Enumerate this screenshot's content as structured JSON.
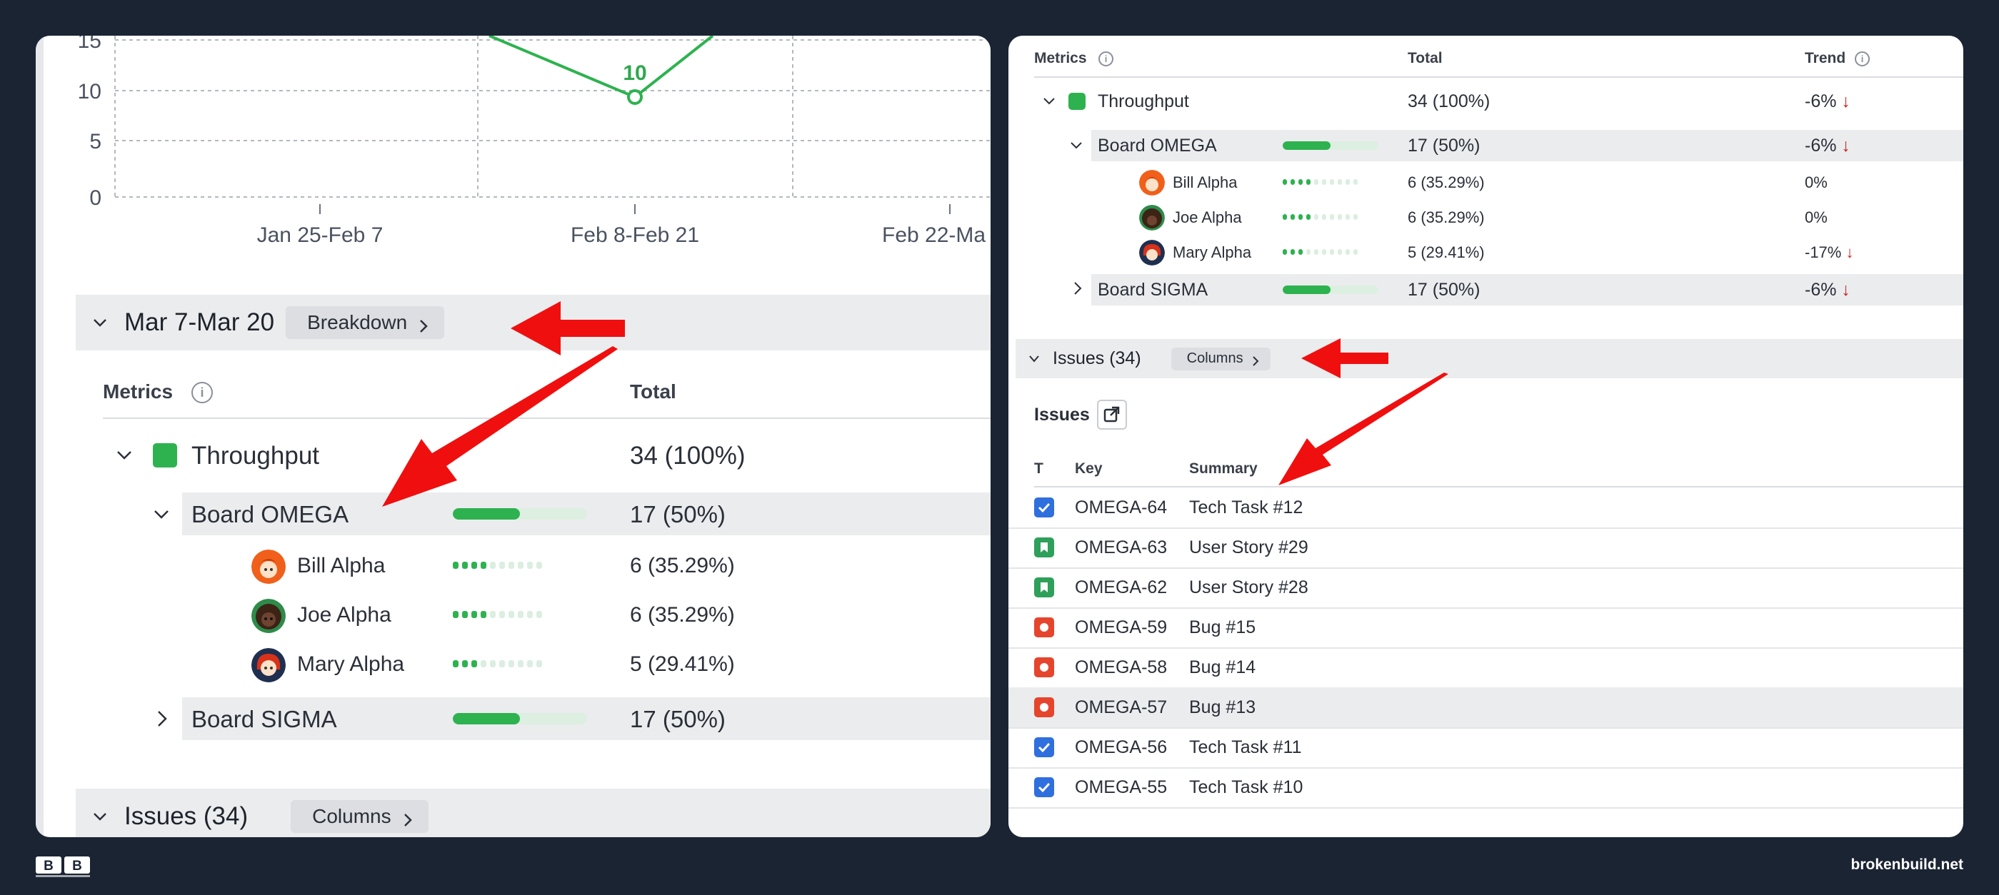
{
  "left": {
    "chart": {
      "y_ticks": [
        "15",
        "10",
        "5",
        "0"
      ],
      "x_ticks": [
        "Jan 25-Feb 7",
        "Feb 8-Feb 21",
        "Feb 22-Ma"
      ],
      "point_label": "10",
      "line_color": "#2eb24f"
    },
    "period": {
      "label": "Mar 7-Mar 20",
      "button": "Breakdown"
    },
    "metrics": {
      "col_metrics": "Metrics",
      "col_total": "Total",
      "throughput": {
        "label": "Throughput",
        "total": "34 (100%)"
      },
      "board_omega": {
        "label": "Board OMEGA",
        "total": "17 (50%)",
        "progress": 0.5
      },
      "people": [
        {
          "name": "Bill Alpha",
          "total": "6 (35.29%)",
          "dots_on": 4,
          "avatar": "red-hair-avatar"
        },
        {
          "name": "Joe Alpha",
          "total": "6 (35.29%)",
          "dots_on": 4,
          "avatar": "dark-hair-avatar"
        },
        {
          "name": "Mary Alpha",
          "total": "5 (29.41%)",
          "dots_on": 3,
          "avatar": "red-hair-woman-avatar"
        }
      ],
      "board_sigma": {
        "label": "Board SIGMA",
        "total": "17 (50%)",
        "progress": 0.5
      }
    },
    "issues_bar": {
      "label": "Issues (34)",
      "button": "Columns"
    }
  },
  "right": {
    "metrics": {
      "col_metrics": "Metrics",
      "col_total": "Total",
      "col_trend": "Trend",
      "throughput": {
        "label": "Throughput",
        "total": "34 (100%)",
        "trend": "-6%",
        "trend_down": true
      },
      "board_omega": {
        "label": "Board OMEGA",
        "total": "17 (50%)",
        "trend": "-6%",
        "trend_down": true,
        "progress": 0.5
      },
      "people": [
        {
          "name": "Bill Alpha",
          "total": "6 (35.29%)",
          "trend": "0%",
          "trend_down": false,
          "dots_on": 4
        },
        {
          "name": "Joe Alpha",
          "total": "6 (35.29%)",
          "trend": "0%",
          "trend_down": false,
          "dots_on": 4
        },
        {
          "name": "Mary Alpha",
          "total": "5 (29.41%)",
          "trend": "-17%",
          "trend_down": true,
          "dots_on": 3
        }
      ],
      "board_sigma": {
        "label": "Board SIGMA",
        "total": "17 (50%)",
        "trend": "-6%",
        "trend_down": true,
        "progress": 0.5
      }
    },
    "issues_bar": {
      "label": "Issues (34)",
      "button": "Columns"
    },
    "issues": {
      "title": "Issues",
      "col_t": "T",
      "col_key": "Key",
      "col_summary": "Summary",
      "rows": [
        {
          "type": "task",
          "key": "OMEGA-64",
          "summary": "Tech Task #12"
        },
        {
          "type": "story",
          "key": "OMEGA-63",
          "summary": "User Story #29"
        },
        {
          "type": "story",
          "key": "OMEGA-62",
          "summary": "User Story #28"
        },
        {
          "type": "bug",
          "key": "OMEGA-59",
          "summary": "Bug #15"
        },
        {
          "type": "bug",
          "key": "OMEGA-58",
          "summary": "Bug #14"
        },
        {
          "type": "bug",
          "key": "OMEGA-57",
          "summary": "Bug #13",
          "highlighted": true
        },
        {
          "type": "task",
          "key": "OMEGA-56",
          "summary": "Tech Task #11"
        },
        {
          "type": "task",
          "key": "OMEGA-55",
          "summary": "Tech Task #10"
        }
      ]
    }
  },
  "footer": {
    "site": "brokenbuild.net"
  },
  "colors": {
    "accent_green": "#2eb24f",
    "arrow_red": "#f00f0f",
    "task_blue": "#2f6fde",
    "story_green": "#2ea05a",
    "bug_red": "#e5452c",
    "background": "#1b2433"
  }
}
